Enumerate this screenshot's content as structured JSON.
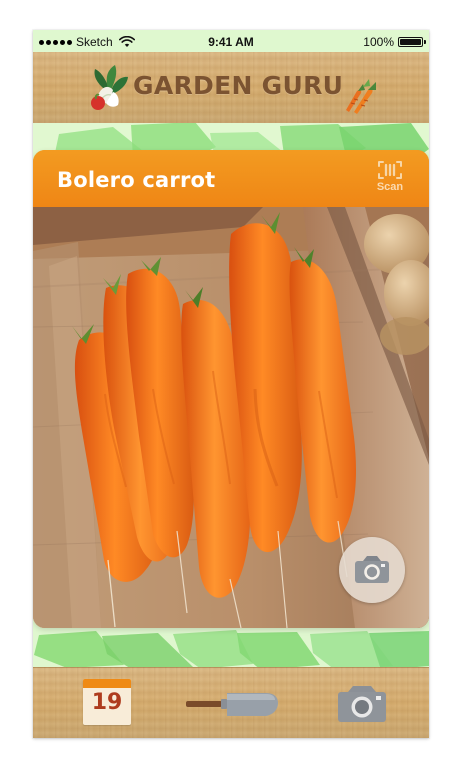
{
  "status_bar": {
    "carrier": "Sketch",
    "time": "9:41 AM",
    "battery_percent": "100%"
  },
  "header": {
    "app_name": "GARDEN GURU"
  },
  "card": {
    "title": "Bolero carrot",
    "scan_label": "Scan"
  },
  "bottom_nav": {
    "calendar_day": "19"
  },
  "colors": {
    "background_green": "#dff7cf",
    "accent_orange": "#f08a13",
    "wood": "#d6b06f",
    "brand_brown": "#7b5331"
  },
  "icons": {
    "brand_left": "vegetable-bundle-icon",
    "brand_right": "carrot-icon",
    "scan": "barcode-scan-icon",
    "camera": "camera-icon",
    "calendar": "calendar-icon",
    "trowel": "garden-trowel-icon"
  }
}
